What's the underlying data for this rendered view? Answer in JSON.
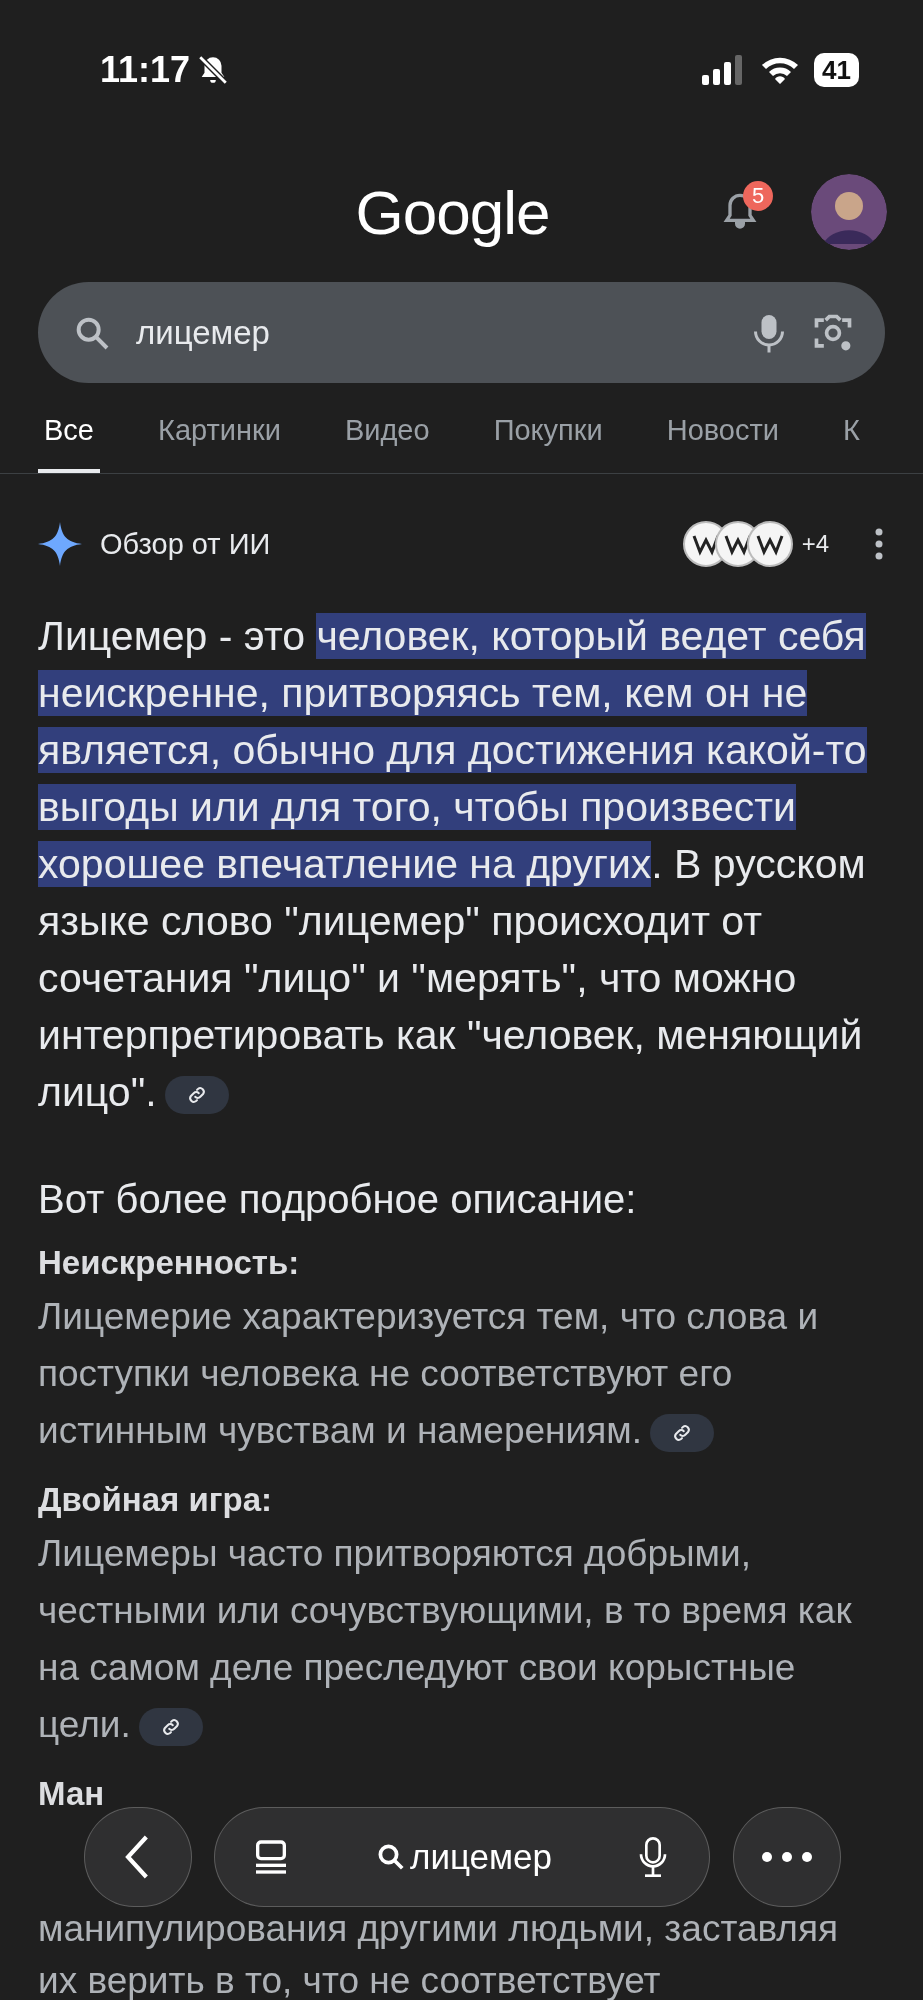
{
  "status_bar": {
    "time": "11:17",
    "battery": "41"
  },
  "header": {
    "logo": "Google",
    "notification_count": "5"
  },
  "search": {
    "value": "лицемер"
  },
  "tabs": [
    {
      "label": "Все",
      "selected": true
    },
    {
      "label": "Картинки",
      "selected": false
    },
    {
      "label": "Видео",
      "selected": false
    },
    {
      "label": "Покупки",
      "selected": false
    },
    {
      "label": "Новости",
      "selected": false
    },
    {
      "label": "К",
      "selected": false
    }
  ],
  "ai_overview": {
    "title": "Обзор от ИИ",
    "sources_more": "+4",
    "intro": [
      {
        "text": "Лицемер - это ",
        "highlighted": false
      },
      {
        "text": "человек, который ведет себя неискренне, притворяясь тем, кем он не является, обычно для достижения какой-то выгоды или для того, чтобы произвести хорошее впечатление на других",
        "highlighted": true
      },
      {
        "text": ". В русском языке слово \"лицемер\" происходит от сочетания \"лицо\" и \"мерять\", что можно интерпретировать как \"человек, меняющий лицо\".",
        "highlighted": false
      }
    ],
    "details_heading": "Вот более подробное описание:",
    "points": [
      {
        "title": "Неискренность:",
        "text": "Лицемерие характеризуется тем, что слова и поступки человека не соответствуют его истинным чувствам и намерениям."
      },
      {
        "title": "Двойная игра:",
        "text": "Лицемеры часто притворяются добрыми, честными или сочувствующими, в то время как на самом деле преследуют свои корыстные цели."
      }
    ],
    "partial_point": {
      "title": "Ман",
      "lines": [
        "манипулирования другими людьми, заставляя",
        "их верить в то, что не соответствует"
      ]
    }
  },
  "bottom_bar": {
    "query": "лицемер"
  }
}
